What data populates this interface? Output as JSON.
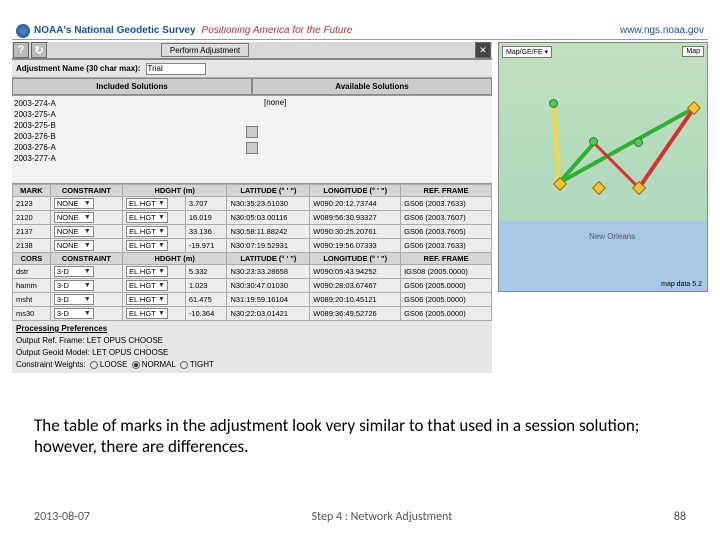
{
  "header": {
    "brand_prefix": "NOAA's",
    "brand_bold": "National Geodetic Survey",
    "tagline": "Positioning America for the Future",
    "url": "www.ngs.noaa.gov"
  },
  "toolbar": {
    "perform": "Perform Adjustment",
    "help": "?",
    "refresh": "↻",
    "close": "✕"
  },
  "adjName": {
    "label": "Adjustment Name (30 char max):",
    "value": "Trial"
  },
  "solHeads": {
    "left": "Included Solutions",
    "right": "Available Solutions"
  },
  "included": [
    "2003-274-A",
    "2003-275-A",
    "2003-275-B",
    "2003-276-B",
    "2003-276-A",
    "2003-277-A"
  ],
  "available": "[none]",
  "markHead": [
    "MARK",
    "CONSTRAINT",
    "",
    "HDGHT (m)",
    "LATITUDE (° ' \")",
    "LONGITUDE (° ' \")",
    "REF. FRAME"
  ],
  "marks": [
    {
      "id": "2123",
      "con": "NONE",
      "h": "EL HGT",
      "hv": "3.707",
      "lat": "N30:35:23.51030",
      "lon": "W090:20:12.73744",
      "rf": "GS06 (2003.7633)"
    },
    {
      "id": "2120",
      "con": "NONE",
      "h": "EL HGT",
      "hv": "16.019",
      "lat": "N30:05:03.00116",
      "lon": "W089:56:30.93327",
      "rf": "GS06 (2003.7607)"
    },
    {
      "id": "2137",
      "con": "NONE",
      "h": "EL HGT",
      "hv": "33.136",
      "lat": "N30:58:11.88242",
      "lon": "W090:30:25.20761",
      "rf": "GS06 (2003.7605)"
    },
    {
      "id": "2138",
      "con": "NONE",
      "h": "EL HGT",
      "hv": "-19.971",
      "lat": "N30:07:19.52931",
      "lon": "W090:19:56.07333",
      "rf": "GS06 (2003.7633)"
    }
  ],
  "corsHead": [
    "CORS",
    "CONSTRAINT",
    "",
    "HDGHT (m)",
    "LATITUDE (° ' \")",
    "LONGITUDE (° ' \")",
    "REF. FRAME"
  ],
  "cors": [
    {
      "id": "dstr",
      "con": "3-D",
      "h": "EL HGT",
      "hv": "5.332",
      "lat": "N30:23:33.28658",
      "lon": "W090:05:43.94252",
      "rf": "IGS08 (2005.0000)"
    },
    {
      "id": "hamm",
      "con": "3-D",
      "h": "EL HGT",
      "hv": "1.023",
      "lat": "N30:30:47.01030",
      "lon": "W090:28:03.67467",
      "rf": "GS06 (2005.0000)"
    },
    {
      "id": "msht",
      "con": "3-D",
      "h": "EL HGT",
      "hv": "61.475",
      "lat": "N31:19:59.16104",
      "lon": "W089:20:10.45121",
      "rf": "GS06 (2005.0000)"
    },
    {
      "id": "ms30",
      "con": "3-D",
      "h": "EL HGT",
      "hv": "-10.364",
      "lat": "N30:22:03.01421",
      "lon": "W089:36:49.52726",
      "rf": "GS06 (2005.0000)"
    }
  ],
  "proc": {
    "hdr": "Processing Preferences",
    "r1": {
      "label": "Output Ref. Frame:",
      "a": "LET OPUS CHOOSE"
    },
    "r2": {
      "label": "Output Geoid Model:",
      "a": "LET OPUS CHOOSE"
    },
    "r3": {
      "label": "Constraint Weights:",
      "a": "LOOSE",
      "b": "NORMAL",
      "c": "TIGHT"
    }
  },
  "map": {
    "menu": "Map/GE/FE",
    "go": "Map",
    "credit": "map data 5.2",
    "city": "New Orleans"
  },
  "caption": "The table of marks in the adjustment look very similar to that used in a session solution; however, there are differences.",
  "footer": {
    "date": "2013-08-07",
    "title": "Step 4 : Network Adjustment",
    "page": "88"
  }
}
